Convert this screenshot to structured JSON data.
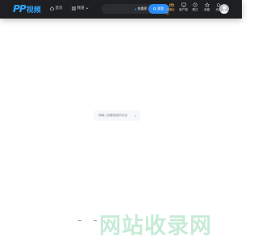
{
  "header": {
    "logo_mark": "PP",
    "logo_text": "视频",
    "nav": {
      "home": "首页",
      "channels": "频道"
    },
    "search": {
      "hot_tag": "热搜榜",
      "button_label": "搜索"
    },
    "right_items": [
      {
        "label": "开通会员",
        "icon": "crown-icon"
      },
      {
        "label": "客户端",
        "icon": "monitor-icon"
      },
      {
        "label": "看过",
        "icon": "clock-icon"
      },
      {
        "label": "收藏",
        "icon": "star-icon"
      },
      {
        "label": "消息",
        "icon": "bell-icon"
      }
    ],
    "accent_color": "#2a8cf7",
    "vip_color": "#f3a33b"
  },
  "main": {
    "empty_hint": "请输入您要搜索的内容",
    "arrow": "»"
  },
  "watermark": "网站收录网"
}
